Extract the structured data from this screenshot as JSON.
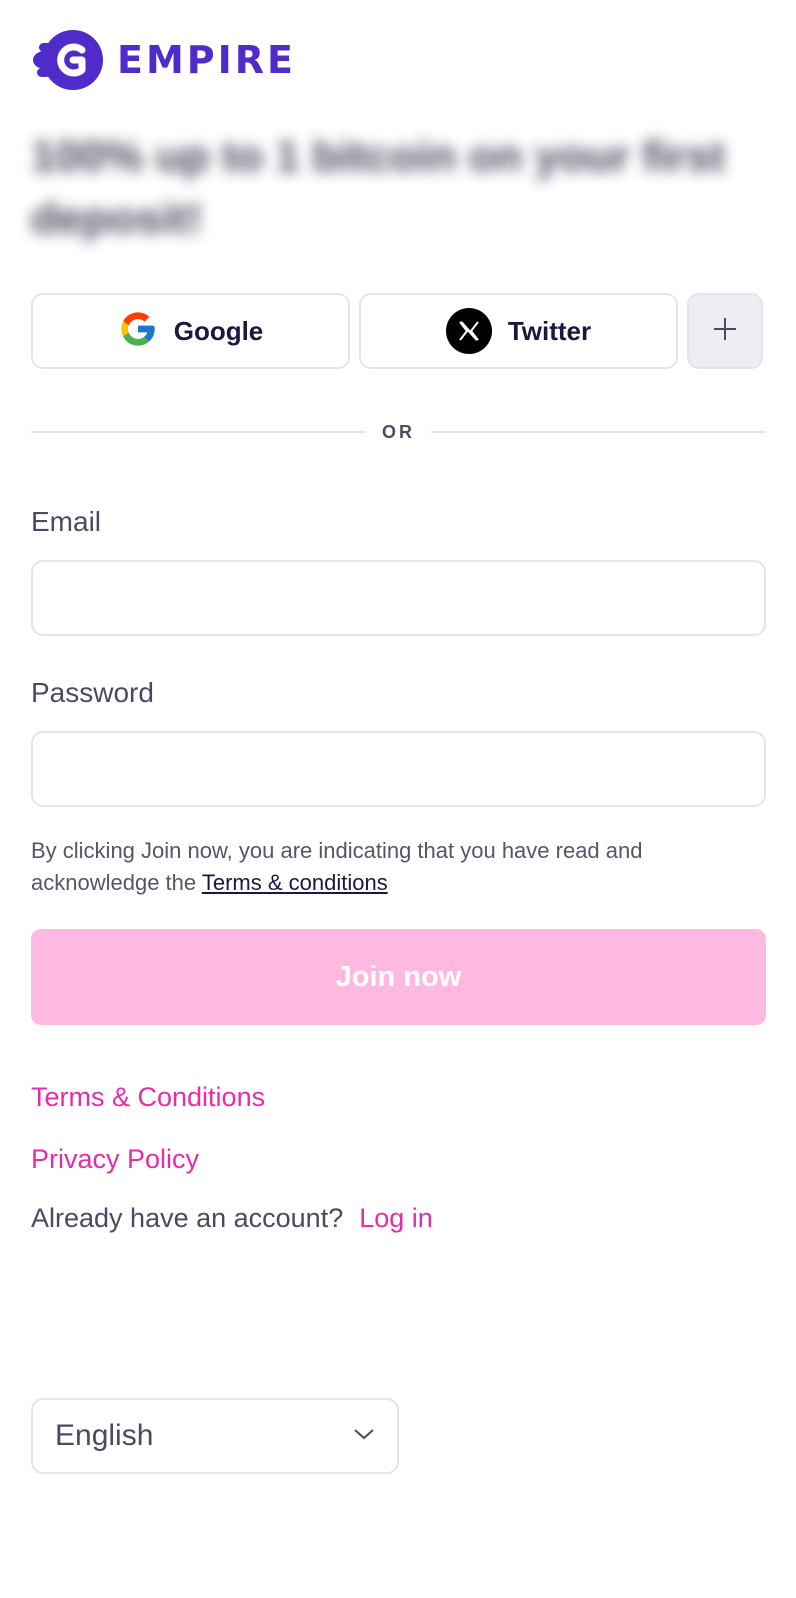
{
  "brand": {
    "name": "EMPIRE",
    "color": "#4f2cc9"
  },
  "promo_headline": "100% up to 1 bitcoin on your first deposit!",
  "social": {
    "google_label": "Google",
    "twitter_label": "Twitter",
    "more_icon": "plus-icon"
  },
  "divider_text": "OR",
  "form": {
    "email_label": "Email",
    "email_value": "",
    "password_label": "Password",
    "password_value": ""
  },
  "consent": {
    "text": "By clicking Join now, you are indicating that you have read and acknowledge the",
    "link": "Terms & conditions"
  },
  "join_button": "Join now",
  "footer_links": {
    "terms": "Terms & Conditions",
    "privacy": "Privacy Policy",
    "already_text": "Already have an account?",
    "login": "Log in"
  },
  "language": {
    "selected": "English"
  },
  "colors": {
    "accent_pink": "#e62ca8",
    "join_disabled": "#feb9e0"
  }
}
